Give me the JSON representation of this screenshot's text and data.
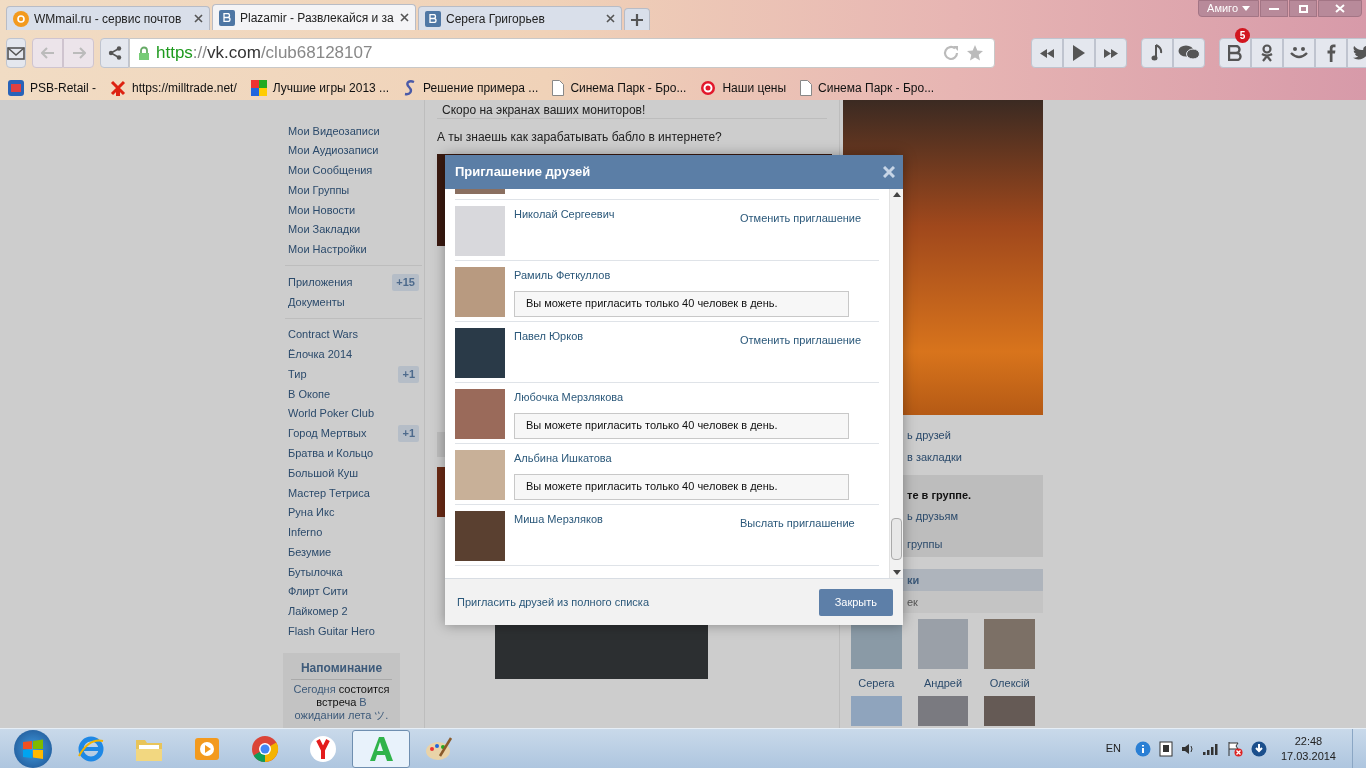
{
  "browser": {
    "tabs": [
      {
        "title": "WMmail.ru - сервис почтов",
        "selected": false
      },
      {
        "title": "Plazamir - Развлекайся и за",
        "selected": true
      },
      {
        "title": "Серега Григорьев",
        "selected": false
      }
    ],
    "menu_label": "Амиго",
    "url_parts": [
      {
        "text": "https",
        "kind": "scheme"
      },
      {
        "text": "://",
        "kind": "path"
      },
      {
        "text": "vk.com",
        "kind": "host"
      },
      {
        "text": "/club68128107",
        "kind": "path"
      }
    ],
    "notification_count": "5",
    "bookmarks": [
      {
        "title": "PSB-Retail -"
      },
      {
        "title": "https://milltrade.net/"
      },
      {
        "title": "Лучшие игры 2013 ..."
      },
      {
        "title": "Решение примера ..."
      },
      {
        "title": "Синема Парк - Бро..."
      },
      {
        "title": "Наши цены"
      },
      {
        "title": "Синема Парк - Бро..."
      }
    ]
  },
  "sidebar": {
    "groups": [
      [
        {
          "label": "Мои Видеозаписи"
        },
        {
          "label": "Мои Аудиозаписи"
        },
        {
          "label": "Мои Сообщения"
        },
        {
          "label": "Мои Группы"
        },
        {
          "label": "Мои Новости"
        },
        {
          "label": "Мои Закладки"
        },
        {
          "label": "Мои Настройки"
        }
      ],
      [
        {
          "label": "Приложения",
          "badge": "+15"
        },
        {
          "label": "Документы"
        }
      ],
      [
        {
          "label": "Contract Wars"
        },
        {
          "label": "Ёлочка 2014"
        },
        {
          "label": "Тир",
          "badge": "+1"
        },
        {
          "label": "В Окопе"
        },
        {
          "label": "World Poker Club"
        },
        {
          "label": "Город Мертвых",
          "badge": "+1"
        },
        {
          "label": "Братва и Кольцо"
        },
        {
          "label": "Большой Куш"
        },
        {
          "label": "Мастер Тетриса"
        },
        {
          "label": "Руна Икс"
        },
        {
          "label": "Inferno"
        },
        {
          "label": "Безумие"
        },
        {
          "label": "Бутылочка"
        },
        {
          "label": "Флирт Сити"
        },
        {
          "label": "Лайкомер 2"
        },
        {
          "label": "Flash Guitar Hero"
        }
      ]
    ],
    "reminder": {
      "title": "Напоминание",
      "text": "Сегодня **состоится встреча** В ожидании лета ツ."
    }
  },
  "feed": {
    "post_caption": "Скоро на экранах ваших мониторов!",
    "post_text": "А ты знаешь как зарабатывать бабло в интернете?"
  },
  "right_column": {
    "links": [
      "ь друзей",
      "в закладки"
    ],
    "member_box": {
      "title": "те в группе.",
      "links": [
        "ь друзьям",
        "группы"
      ]
    },
    "friends_header": "ки",
    "friends_sub": "ек",
    "friends": [
      {
        "name": "Серега"
      },
      {
        "name": "Андрей"
      },
      {
        "name": "Олексій"
      }
    ]
  },
  "modal": {
    "title": "Приглашение друзей",
    "rows": [
      {
        "name": "Николай Сергеевич",
        "kind": "link",
        "action": "Отменить приглашение"
      },
      {
        "name": "Рамиль Феткуллов",
        "kind": "notice",
        "action": "Вы можете пригласить только 40 человек в день."
      },
      {
        "name": "Павел Юрков",
        "kind": "link",
        "action": "Отменить приглашение"
      },
      {
        "name": "Любочка Мерзлякова",
        "kind": "notice",
        "action": "Вы можете пригласить только 40 человек в день."
      },
      {
        "name": "Альбина Ишкатова",
        "kind": "notice",
        "action": "Вы можете пригласить только 40 человек в день."
      },
      {
        "name": "Миша Мерзляков",
        "kind": "link",
        "action": "Выслать приглашение"
      }
    ],
    "footer_link": "Пригласить друзей из полного списка",
    "close_button": "Закрыть"
  },
  "taskbar": {
    "apps": [
      {
        "selected": false
      },
      {
        "selected": false
      },
      {
        "selected": false
      },
      {
        "selected": false
      },
      {
        "selected": false
      },
      {
        "selected": true
      },
      {
        "selected": false
      }
    ],
    "language": "EN",
    "time": "22:48",
    "date": "17.03.2014"
  }
}
